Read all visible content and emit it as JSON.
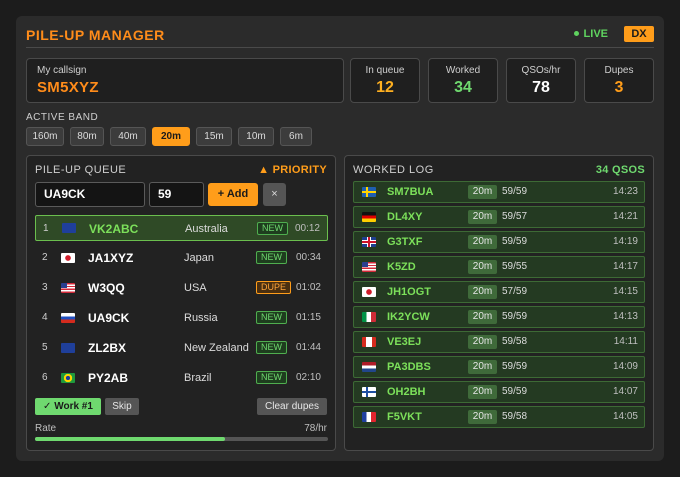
{
  "header": {
    "title": "PILE-UP MANAGER",
    "live": "LIVE",
    "mode_badge": "DX"
  },
  "station": {
    "label": "My callsign",
    "callsign": "SM5XYZ"
  },
  "stats": [
    {
      "label": "In queue",
      "value": "12",
      "color": "#ffb020"
    },
    {
      "label": "Worked",
      "value": "34",
      "color": "#6fd96f"
    },
    {
      "label": "QSOs/hr",
      "value": "78",
      "color": "#ffffff"
    },
    {
      "label": "Dupes",
      "value": "3",
      "color": "#ff9d1a"
    }
  ],
  "bands": {
    "label": "ACTIVE BAND",
    "items": [
      "160m",
      "80m",
      "40m",
      "20m",
      "15m",
      "10m",
      "6m"
    ],
    "active": "20m"
  },
  "queue": {
    "title": "PILE-UP QUEUE",
    "priority": "▲ PRIORITY",
    "input_call": "UA9CK",
    "input_rst": "59",
    "add_label": "+ Add",
    "clear_label": "×",
    "rows": [
      {
        "idx": "1",
        "flag": "AU",
        "call": "VK2ABC",
        "country": "Australia",
        "status": "NEW",
        "time": "00:12"
      },
      {
        "idx": "2",
        "flag": "JP",
        "call": "JA1XYZ",
        "country": "Japan",
        "status": "NEW",
        "time": "00:34"
      },
      {
        "idx": "3",
        "flag": "US",
        "call": "W3QQ",
        "country": "USA",
        "status": "DUPE",
        "time": "01:02"
      },
      {
        "idx": "4",
        "flag": "RU",
        "call": "UA9CK",
        "country": "Russia",
        "status": "NEW",
        "time": "01:15"
      },
      {
        "idx": "5",
        "flag": "NZ",
        "call": "ZL2BX",
        "country": "New Zealand",
        "status": "NEW",
        "time": "01:44"
      },
      {
        "idx": "6",
        "flag": "BR",
        "call": "PY2AB",
        "country": "Brazil",
        "status": "NEW",
        "time": "02:10"
      }
    ],
    "work_label": "✓ Work #1",
    "skip_label": "Skip",
    "clear_dupes_label": "Clear dupes",
    "rate_label": "Rate",
    "rate_value": "78/hr",
    "rate_fraction": 0.65
  },
  "log": {
    "title": "WORKED LOG",
    "count": "34 QSOS",
    "rows": [
      {
        "flag": "SE",
        "call": "SM7BUA",
        "band": "20m",
        "rst": "59/59",
        "time": "14:23"
      },
      {
        "flag": "DE",
        "call": "DL4XY",
        "band": "20m",
        "rst": "59/57",
        "time": "14:21"
      },
      {
        "flag": "GB",
        "call": "G3TXF",
        "band": "20m",
        "rst": "59/59",
        "time": "14:19"
      },
      {
        "flag": "US",
        "call": "K5ZD",
        "band": "20m",
        "rst": "59/55",
        "time": "14:17"
      },
      {
        "flag": "JP",
        "call": "JH1OGT",
        "band": "20m",
        "rst": "57/59",
        "time": "14:15"
      },
      {
        "flag": "IT",
        "call": "IK2YCW",
        "band": "20m",
        "rst": "59/59",
        "time": "14:13"
      },
      {
        "flag": "CA",
        "call": "VE3EJ",
        "band": "20m",
        "rst": "59/58",
        "time": "14:11"
      },
      {
        "flag": "NL",
        "call": "PA3DBS",
        "band": "20m",
        "rst": "59/59",
        "time": "14:09"
      },
      {
        "flag": "FI",
        "call": "OH2BH",
        "band": "20m",
        "rst": "59/59",
        "time": "14:07"
      },
      {
        "flag": "FR",
        "call": "F5VKT",
        "band": "20m",
        "rst": "59/58",
        "time": "14:05"
      }
    ]
  }
}
